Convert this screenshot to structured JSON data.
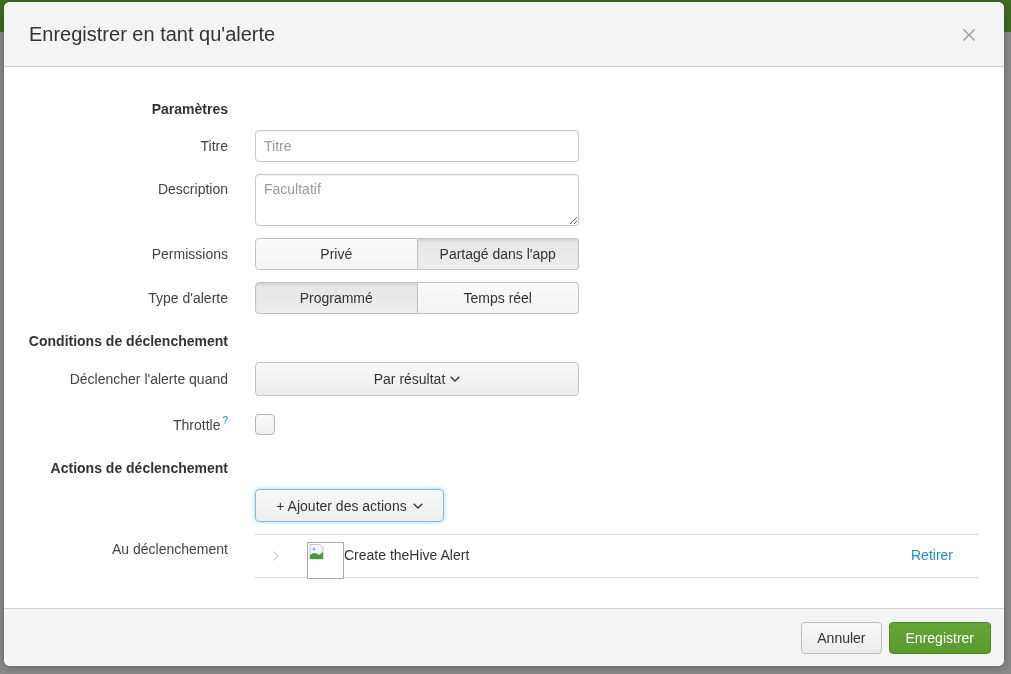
{
  "dialog": {
    "title": "Enregistrer en tant qu'alerte"
  },
  "settings": {
    "heading": "Paramètres",
    "title_field": {
      "label": "Titre",
      "placeholder": "Titre"
    },
    "description_field": {
      "label": "Description",
      "placeholder": "Facultatif"
    },
    "permissions": {
      "label": "Permissions",
      "options": [
        {
          "label": "Privé",
          "selected": false
        },
        {
          "label": "Partagé dans l'app",
          "selected": true
        }
      ]
    },
    "alert_type": {
      "label": "Type d'alerte",
      "options": [
        {
          "label": "Programmé",
          "selected": true
        },
        {
          "label": "Temps réel",
          "selected": false
        }
      ]
    }
  },
  "trigger_conditions": {
    "heading": "Conditions de déclenchement",
    "trigger_when": {
      "label": "Déclencher l'alerte quand",
      "value": "Par résultat"
    },
    "throttle": {
      "label": "Throttle",
      "help": "?",
      "checked": false
    }
  },
  "trigger_actions": {
    "heading": "Actions de déclenchement",
    "add_button": "+ Ajouter des actions",
    "on_trigger_label": "Au déclenchement",
    "actions": [
      {
        "name": "Create theHive Alert",
        "expanded": false,
        "remove": "Retirer"
      }
    ]
  },
  "footer": {
    "buttons": [
      {
        "label": "Annuler",
        "kind": "secondary"
      },
      {
        "label": "Enregistrer",
        "kind": "primary"
      }
    ]
  }
}
